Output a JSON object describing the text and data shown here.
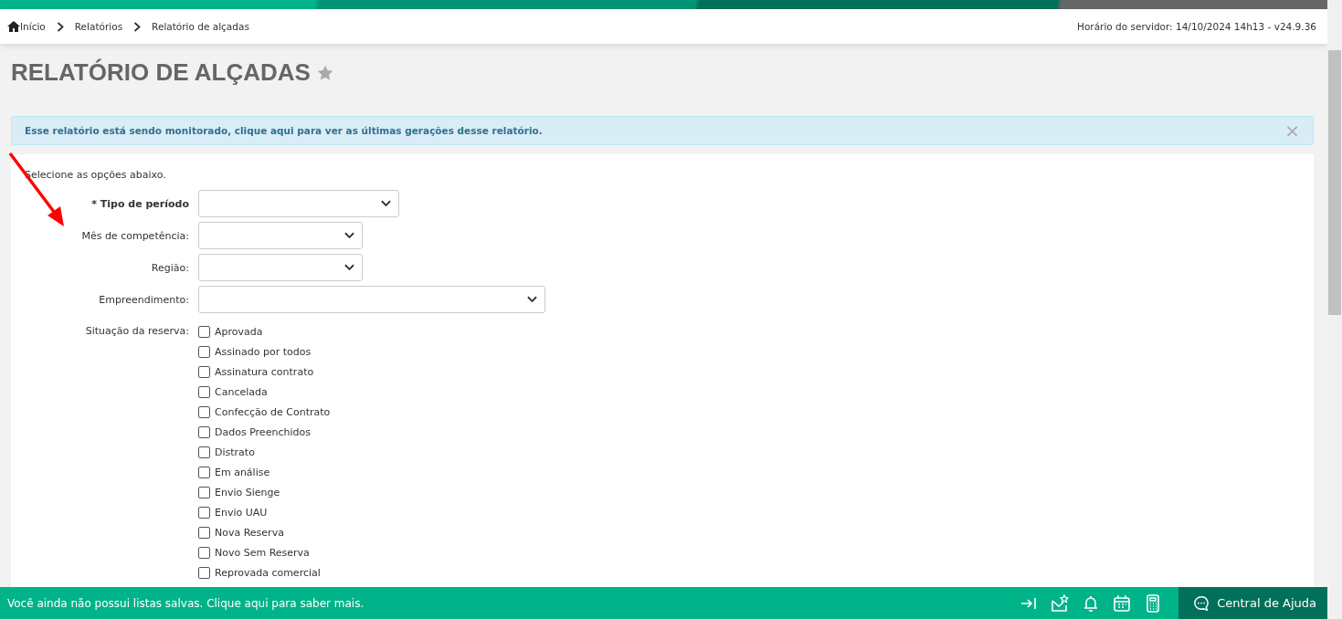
{
  "breadcrumb": [
    {
      "label": "Início"
    },
    {
      "label": "Relatórios"
    },
    {
      "label": "Relatório de alçadas"
    }
  ],
  "server_info": "Horário do servidor: 14/10/2024 14h13 - v24.9.36",
  "title": "RELATÓRIO DE ALÇADAS",
  "favorite": false,
  "alert": {
    "text": "Esse relatório está sendo monitorado, clique aqui para ver as últimas gerações desse relatório.",
    "close": "×"
  },
  "instructions": "Selecione as opções abaixo.",
  "fields": [
    {
      "label": "* Tipo de período",
      "required": true
    },
    {
      "label": "Mês de competência:",
      "required": false
    },
    {
      "label": "Região:",
      "required": false
    },
    {
      "label": "Empreendimento:",
      "required": false
    }
  ],
  "status_label": "Situação da reserva:",
  "statuses": [
    {
      "label": "Aprovada",
      "checked": false
    },
    {
      "label": "Assinado por todos",
      "checked": false
    },
    {
      "label": "Assinatura contrato",
      "checked": false
    },
    {
      "label": "Cancelada",
      "checked": false
    },
    {
      "label": "Confecção de Contrato",
      "checked": false
    },
    {
      "label": "Dados Preenchidos",
      "checked": false
    },
    {
      "label": "Distrato",
      "checked": false
    },
    {
      "label": "Em análise",
      "checked": false
    },
    {
      "label": "Envio Sienge",
      "checked": false
    },
    {
      "label": "Envio UAU",
      "checked": false
    },
    {
      "label": "Nova Reserva",
      "checked": false
    },
    {
      "label": "Novo Sem Reserva",
      "checked": false
    },
    {
      "label": "Reprovada comercial",
      "checked": false
    }
  ],
  "footer": {
    "message": "Você ainda não possui listas salvas. Clique aqui para saber mais.",
    "help": "Central de Ajuda"
  }
}
